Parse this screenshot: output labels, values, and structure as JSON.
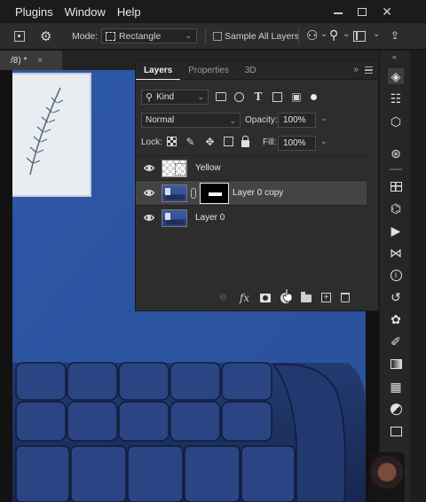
{
  "menubar": {
    "items": [
      "Plugins",
      "Window",
      "Help"
    ]
  },
  "options_bar": {
    "mode_label": "Mode:",
    "mode_value": "Rectangle",
    "sample_all_layers": "Sample All Layers"
  },
  "doc_tab": {
    "title": "/8) *",
    "close": "×"
  },
  "layers_panel": {
    "tabs": [
      "Layers",
      "Properties",
      "3D"
    ],
    "kind_filter": "Kind",
    "blend_mode": "Normal",
    "opacity_label": "Opacity:",
    "opacity_value": "100%",
    "lock_label": "Lock:",
    "fill_label": "Fill:",
    "fill_value": "100%",
    "layers": [
      {
        "name": "Yellow",
        "selected": false
      },
      {
        "name": "Layer 0 copy",
        "selected": true
      },
      {
        "name": "Layer 0",
        "selected": false
      }
    ],
    "footer_fx": "fx"
  },
  "icons": {
    "menubar": [
      "minimize-icon",
      "maximize-icon",
      "close-icon"
    ],
    "options_bar": [
      "rect-marquee-icon",
      "gear-icon",
      "user-icon",
      "search-icon",
      "frame-icon",
      "share-icon"
    ],
    "right_toolbar": [
      "layers-icon",
      "adjustments-icon",
      "3d-cube-icon",
      "channels-icon",
      "grid-icon",
      "swatch-icon",
      "play-icon",
      "paths-icon",
      "info-icon",
      "history-icon",
      "palette-icon",
      "brush-icon",
      "gradient-icon",
      "patterns-icon",
      "circle-half-icon",
      "export-icon"
    ]
  },
  "colors": {
    "canvas_wall": "#2e5aa8",
    "sofa": "#1f3468",
    "panel": "#2d2d2d",
    "selected_row": "#444444"
  }
}
